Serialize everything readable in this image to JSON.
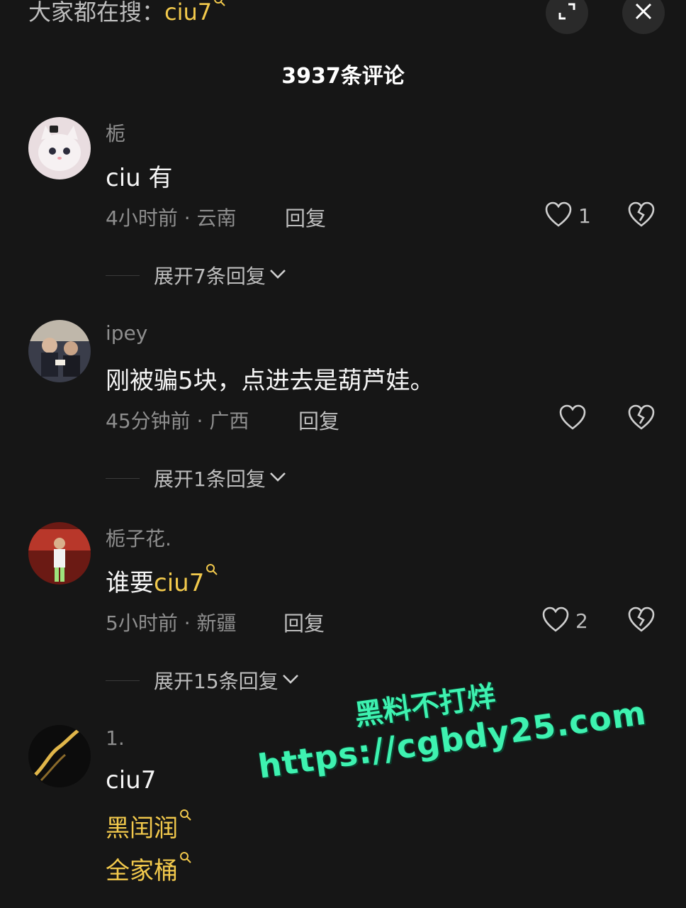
{
  "top": {
    "search_prefix": "大家都在搜：",
    "search_keyword": "ciu7",
    "comment_count_label": "3937条评论"
  },
  "comments": [
    {
      "username": "栀",
      "text": "ciu 有",
      "meta": "4小时前 · 云南",
      "reply_label": "回复",
      "likes": "1",
      "expand_label": "展开7条回复"
    },
    {
      "username": "ipey",
      "text": "刚被骗5块，点进去是葫芦娃。",
      "meta": "45分钟前 · 广西",
      "reply_label": "回复",
      "likes": "",
      "expand_label": "展开1条回复"
    },
    {
      "username": "栀子花.",
      "text_prefix": "谁要",
      "text_keyword": "ciu7",
      "meta": "5小时前 · 新疆",
      "reply_label": "回复",
      "likes": "2",
      "expand_label": "展开15条回复"
    },
    {
      "username": "1.",
      "text": "ciu7",
      "keywords": [
        "黑闰润",
        "全家桶"
      ]
    }
  ],
  "watermark": {
    "line1": "黑料不打烊",
    "line2": "https://cgbdy25.com"
  },
  "colors": {
    "background": "#161616",
    "keyword": "#f2c94c",
    "watermark": "#3ef2b0"
  }
}
